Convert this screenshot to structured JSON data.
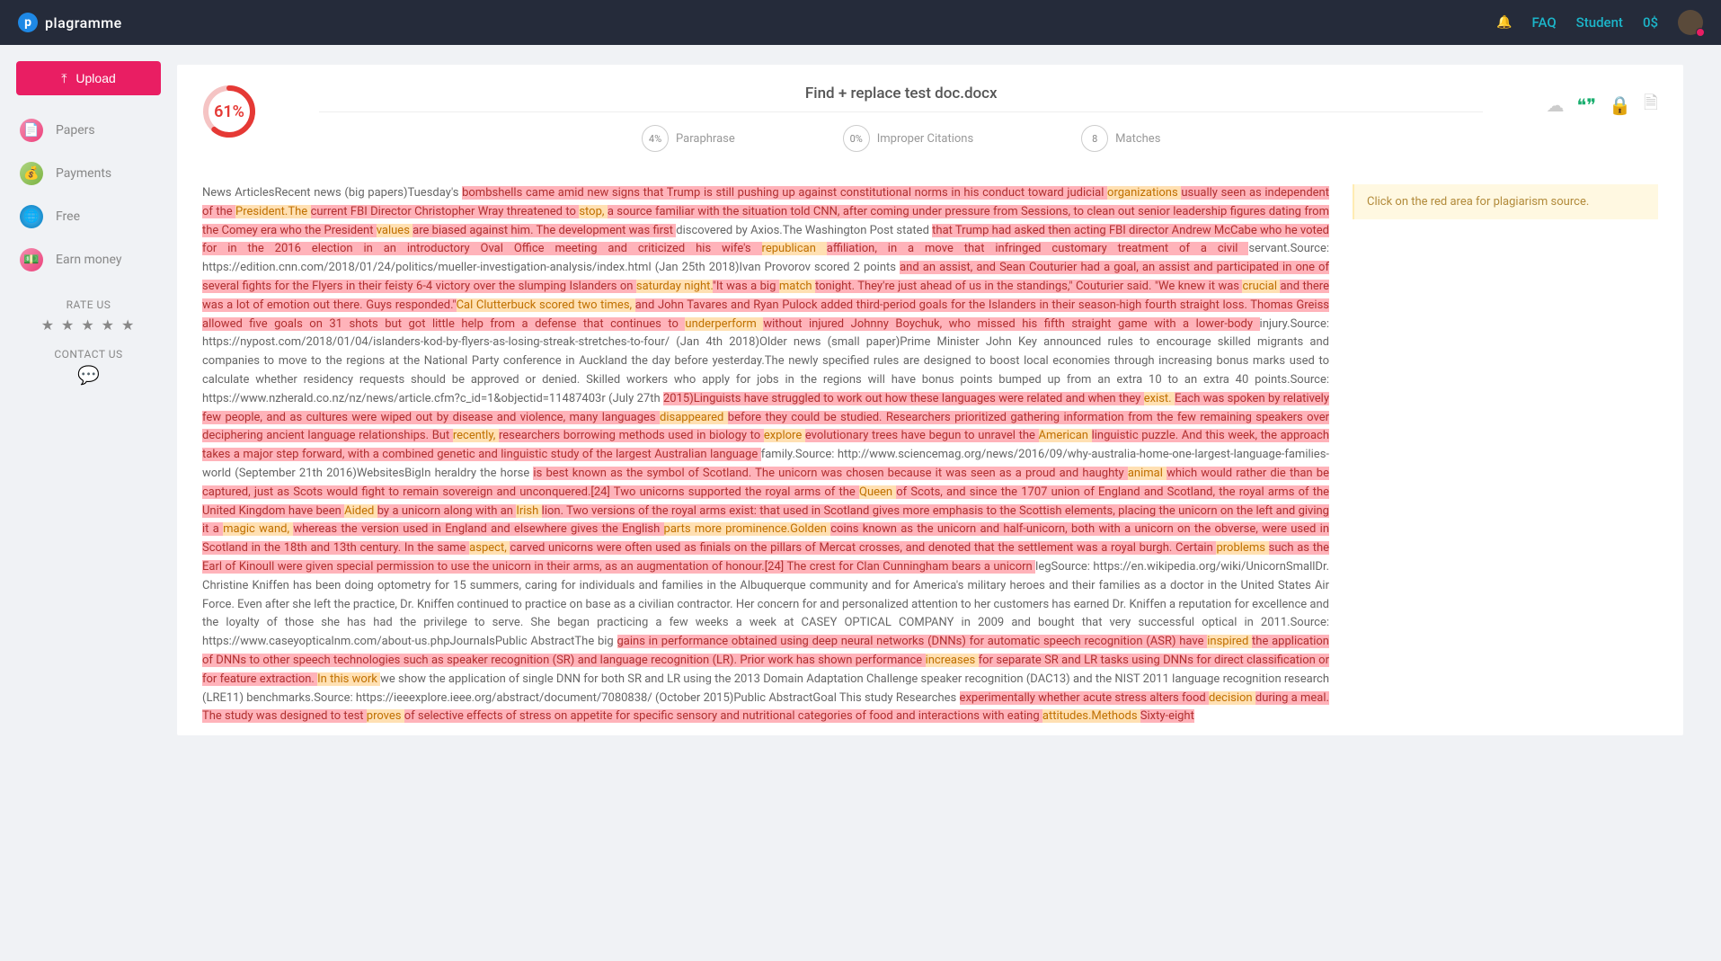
{
  "brand": {
    "name": "plagramme",
    "logo_letter": "p"
  },
  "topbar": {
    "faq": "FAQ",
    "role": "Student",
    "balance": "0$"
  },
  "sidebar": {
    "upload": "Upload",
    "items": [
      {
        "label": "Papers"
      },
      {
        "label": "Payments"
      },
      {
        "label": "Free"
      },
      {
        "label": "Earn money"
      }
    ],
    "rate_label": "RATE US",
    "contact_label": "CONTACT US"
  },
  "doc": {
    "title": "Find + replace test doc.docx",
    "score": "61%",
    "score_value": 61,
    "metrics": [
      {
        "value": "4%",
        "label": "Paraphrase"
      },
      {
        "value": "0%",
        "label": "Improper Citations"
      },
      {
        "value": "8",
        "label": "Matches"
      }
    ]
  },
  "tip": "Click on the red area for plagiarism source.",
  "text": {
    "p1a": "News ArticlesRecent news (big papers)Tuesday's ",
    "p1b": "bombshells came amid new signs that Trump is still pushing up against constitutional norms in his conduct toward judicial ",
    "p1c": "organizations ",
    "p1d": "usually seen ",
    "p1e": "as independent of the ",
    "p1f": "President.The ",
    "p1g": "current FBI Director Christopher Wray threatened to ",
    "p1h": "stop, ",
    "p1i": "a source familiar with the situation told CNN, after coming under pressure from Sessions, to clean out senior leadership figures dating from the Comey era who the President ",
    "p1j": "values ",
    "p1k": "are biased against him. The development was first ",
    "p1l": "discovered by Axios.The Washington Post stated ",
    "p1m": "that Trump had asked then acting FBI director Andrew McCabe who he voted for in the 2016 election in an introductory Oval Office meeting and criticized his wife's ",
    "p1n": "republican ",
    "p1o": "affiliation, in a move that infringed customary treatment of a civil ",
    "p1p": "servant.Source: https://edition.cnn.com/2018/01/24/politics/mueller-investigation-analysis/index.html (Jan 25th 2018)Ivan Provorov scored 2 points ",
    "p1q": "and an assist, and Sean Couturier had a goal, an assist and participated in one of several fights for the Flyers in their feisty 6-4 victory over the slumping Islanders on ",
    "p1r": "saturday night.",
    "p1s": "\"It was a big ",
    "p1t": "match ",
    "p1u": "tonight. They're just ahead of us in the standings,\" Couturier said. \"We knew it was ",
    "p1v": "crucial ",
    "p1w": "and there was a lot of emotion out there. Guys responded.\"",
    "p1x": "Cal Clutterbuck scored two times, ",
    "p1y": "and John Tavares and Ryan Pulock added third-period goals for the Islanders in their season-high fourth straight loss. Thomas Greiss allowed five goals on 31 shots but got little help from a defense that continues to ",
    "p1z": "underperform ",
    "p2a": "without injured Johnny Boychuk, who missed his ",
    "p2b": "fifth straight game with a lower-body ",
    "p2c": "injury.Source: https://nypost.com/2018/01/04/islanders-kod-by-flyers-as-losing-streak-stretches-to-four/ (Jan 4th 2018)Older news (small paper)Prime Minister John Key announced rules to encourage skilled migrants and companies to move to the regions at the National Party conference in Auckland the day before yesterday.The newly specified rules are designed to boost local economies through increasing bonus marks used to calculate whether residency requests should be approved or denied. Skilled workers who apply for jobs in the regions will have bonus points bumped up from an extra 10 to an extra 40 points.Source: https://www.nzherald.co.nz/nz/news/article.cfm?c_id=1&objectid=11487403r (July 27th ",
    "p2d": "2015)",
    "p2e": "Linguists have struggled to work out how these languages were related and when they ",
    "p2f": "exist. ",
    "p2g": "Each was spoken by relatively few people, and as cultures were wiped out by disease and violence, many languages ",
    "p2h": "disappeared ",
    "p2i": "before they could be studied. Researchers prioritized gathering information from the few remaining speakers over deciphering ancient language relationships. But ",
    "p2j": "recently, ",
    "p2k": "researchers borrowing methods used in biology to ",
    "p2l": "explore ",
    "p2m": "evolutionary trees have begun to unravel the ",
    "p2n": "American ",
    "p2o": "linguistic puzzle. And this week, the approach takes a major step forward, with a combined genetic and linguistic study of the largest Australian language ",
    "p2p": "family.Source: http://www.sciencemag.org/news/2016/09/why-australia-home-one-largest-language-families-world (September 21th 2016)WebsitesBigIn heraldry the horse ",
    "p2q": "is best known as the symbol of Scotland. The unicorn was chosen because it was seen as a proud and haughty ",
    "p2r": "animal ",
    "p2s": "which would rather die than be captured, just as Scots would fight to remain sovereign and unconquered.[24] Two unicorns supported the royal arms of the ",
    "p2t": "Queen ",
    "p2u": "of Scots, and since the 1707 union of England and Scotland, the royal arms of the United Kingdom have been ",
    "p2v": "Aided ",
    "p2w": "by a unicorn along with an ",
    "p2x": "Irish ",
    "p2y": "lion. Two versions of the royal arms exist: that used in Scotland gives more emphasis to the Scottish elements, placing the unicorn on the left and giving it a ",
    "p2z": "magic wand, ",
    "p3a": "whereas the version used in England and elsewhere gives the English ",
    "p3b": "parts more prominence.Golden ",
    "p3c": "coins known as the unicorn and half-unicorn, both with a unicorn on the obverse, were used in Scotland in the 18th and 13th century. In the same ",
    "p3d": "aspect, ",
    "p3e": "carved unicorns were often used as finials on the pillars of Mercat crosses, ",
    "p3f": "and denoted that the settlement was a royal burgh. Certain ",
    "p3g": "problems ",
    "p3h": "such as the Earl of Kinoull were given special permission to use the unicorn in their arms, as an augmentation of honour.[24] ",
    "p3i": "The crest for Clan Cunningham bears a unicorn ",
    "p3j": "legSource: https://en.wikipedia.org/wiki/UnicornSmallDr. Christine Kniffen has been doing optometry for 15 summers, caring for individuals and families in the Albuquerque community and for America's military heroes and their families as a doctor in the United States Air Force. Even after she left the practice, Dr. Kniffen continued to practice on base as a civilian contractor. Her concern for and personalized attention to her customers has earned Dr. Kniffen a reputation for excellence and the loyalty of those she has had the privilege to serve. She began practicing a few weeks a week at CASEY OPTICAL COMPANY in 2009 and bought that very successful optical in 2011.Source: https://www.caseyopticalnm.com/about-us.phpJournalsPublic AbstractThe big ",
    "p3k": "gains in performance obtained using deep neural networks (DNNs) for automatic speech recognition (ASR) have ",
    "p3l": "inspired ",
    "p3m": "the application of DNNs to other speech technologies such as speaker recognition (SR) and language recognition (LR). Prior work has shown performance ",
    "p3n": "increases ",
    "p3o": "for separate SR and LR tasks using DNNs for direct classification or for feature extraction. ",
    "p3p": "In this work ",
    "p3q": "we show the application of single DNN for both SR and LR using the 2013 Domain Adaptation Challenge speaker recognition (DAC13) and the NIST 2011 language recognition research (LRE11) benchmarks.Source: https://ieeexplore.ieee.org/abstract/document/7080838/ (October 2015)Public AbstractGoal This study Researches ",
    "p3r": "experimentally whether acute stress alters food ",
    "p3s": "decision ",
    "p3t": "during a meal. The study was designed to test ",
    "p3u": "proves ",
    "p3v": "of selective effects of stress on appetite for specific sensory and nutritional categories of food and interactions with eating ",
    "p3w": "attitudes.Methods ",
    "p3x": "Sixty-eight"
  }
}
